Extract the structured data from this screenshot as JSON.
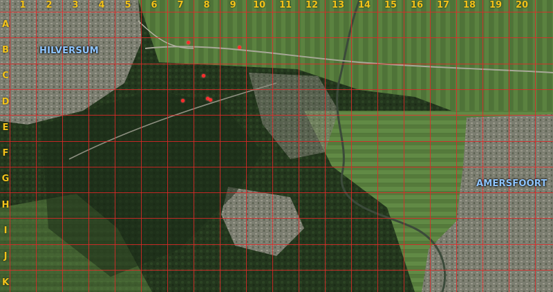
{
  "map": {
    "columns": [
      "1",
      "2",
      "3",
      "4",
      "5",
      "6",
      "7",
      "8",
      "9",
      "10",
      "11",
      "12",
      "13",
      "14",
      "15",
      "16",
      "17",
      "18",
      "19",
      "20"
    ],
    "rows": [
      "A",
      "B",
      "C",
      "D",
      "E",
      "F",
      "G",
      "H",
      "I",
      "J",
      "K"
    ],
    "towns": {
      "hilversum": "HILVERSUM",
      "amersfoort": "AMERSFOORT"
    },
    "colors": {
      "grid": "#e12828",
      "column_labels": "#f2c21a",
      "row_labels": "#f2c21a",
      "town_labels": "#8ec5ff",
      "markers": "#ff2b2b"
    },
    "marker_count": 6
  }
}
